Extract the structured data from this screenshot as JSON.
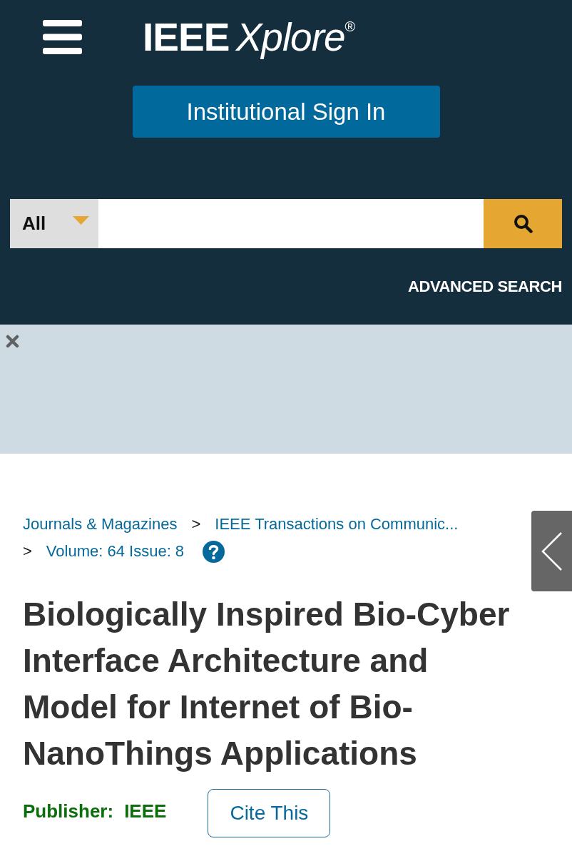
{
  "header": {
    "logo": {
      "brand": "IEEE",
      "product": "Xplore",
      "mark": "®"
    },
    "sign_in_button": "Institutional Sign In"
  },
  "search": {
    "scope": "All",
    "advanced_search_link": "ADVANCED SEARCH"
  },
  "breadcrumbs": [
    {
      "text": "Journals & Magazines"
    },
    {
      "separator": ">",
      "text": "IEEE Transactions on Communic..."
    },
    {
      "separator": ">",
      "text": "Volume: 64 Issue: 8"
    }
  ],
  "article": {
    "title": "Biologically Inspired Bio-Cyber Interface Architecture and Model for Internet of Bio-NanoThings Applications",
    "publisher_label": "Publisher:",
    "publisher": "IEEE",
    "cite_button": "Cite This"
  }
}
